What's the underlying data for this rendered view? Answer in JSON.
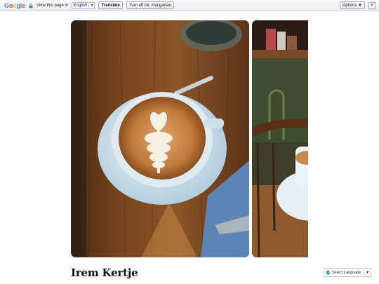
{
  "translate_bar": {
    "logo": [
      "G",
      "o",
      "o",
      "g",
      "l",
      "e"
    ],
    "prompt": "View this page in:",
    "language": "English",
    "language_caret": "▼",
    "translate_button": "Translate",
    "turn_off_button": "Turn off for: Hungarian",
    "options_button": "Options ▼",
    "close_glyph": "✕"
  },
  "gallery": {
    "photos": [
      {
        "name": "latte-art-cup",
        "palette": [
          "#6b3b1b",
          "#c98a4f",
          "#d8e6ef"
        ]
      },
      {
        "name": "cafe-interior-cup",
        "palette": [
          "#3f3c26",
          "#7a4a2a",
          "#e7eff6"
        ]
      }
    ]
  },
  "page": {
    "title": "Irem Kertje"
  },
  "language_widget": {
    "label": "Select Language",
    "arrow": "▼"
  },
  "colors": {
    "google_blue": "#4285f4",
    "google_red": "#ea4335",
    "google_yellow": "#fbbc05",
    "google_green": "#34a853"
  }
}
